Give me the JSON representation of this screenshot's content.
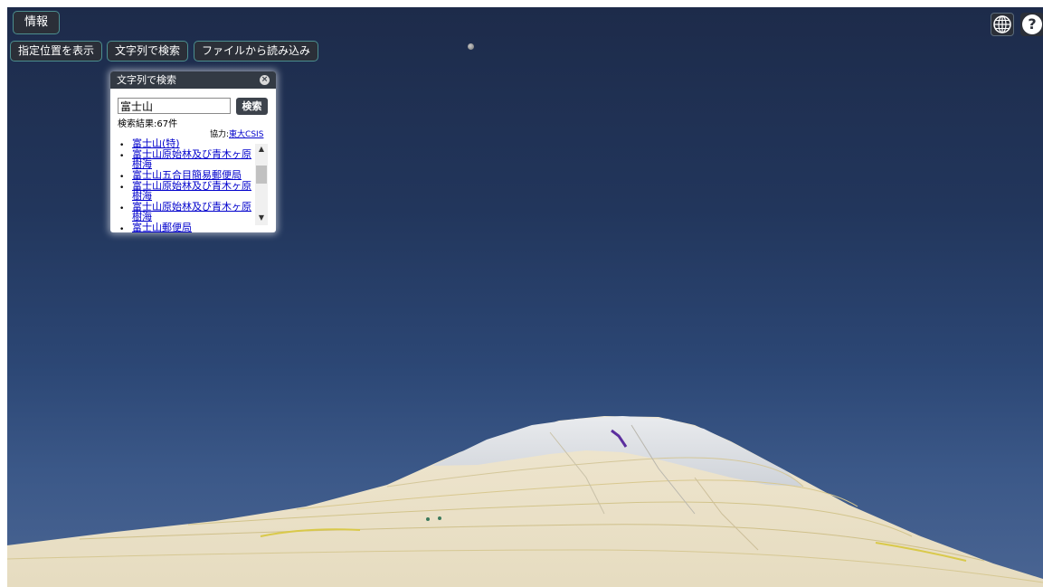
{
  "toolbar": {
    "info_label": "情報",
    "show_position_label": "指定位置を表示",
    "text_search_label": "文字列で検索",
    "file_load_label": "ファイルから読み込み"
  },
  "top_right": {
    "globe_icon": "globe-icon",
    "help_label": "?"
  },
  "search_panel": {
    "title": "文字列で検索",
    "close_icon": "close-icon",
    "query_value": "富士山",
    "search_button_label": "検索",
    "result_count": "検索結果:67件",
    "credit_prefix": "協力:",
    "credit_link": "東大CSIS",
    "results": [
      "富士山(特)",
      "富士山原始林及び青木ヶ原樹海",
      "富士山五合目簡易郵便局",
      "富士山原始林及び青木ヶ原樹海",
      "富士山原始林及び青木ヶ原樹海",
      "富士山郵便局"
    ]
  },
  "colors": {
    "sky_top": "#1d2b4a",
    "sky_bottom": "#4a6593",
    "button_bg": "#2b2f38",
    "button_border": "#4c8e8e",
    "panel_header": "#333a44",
    "link": "#0000cc"
  }
}
